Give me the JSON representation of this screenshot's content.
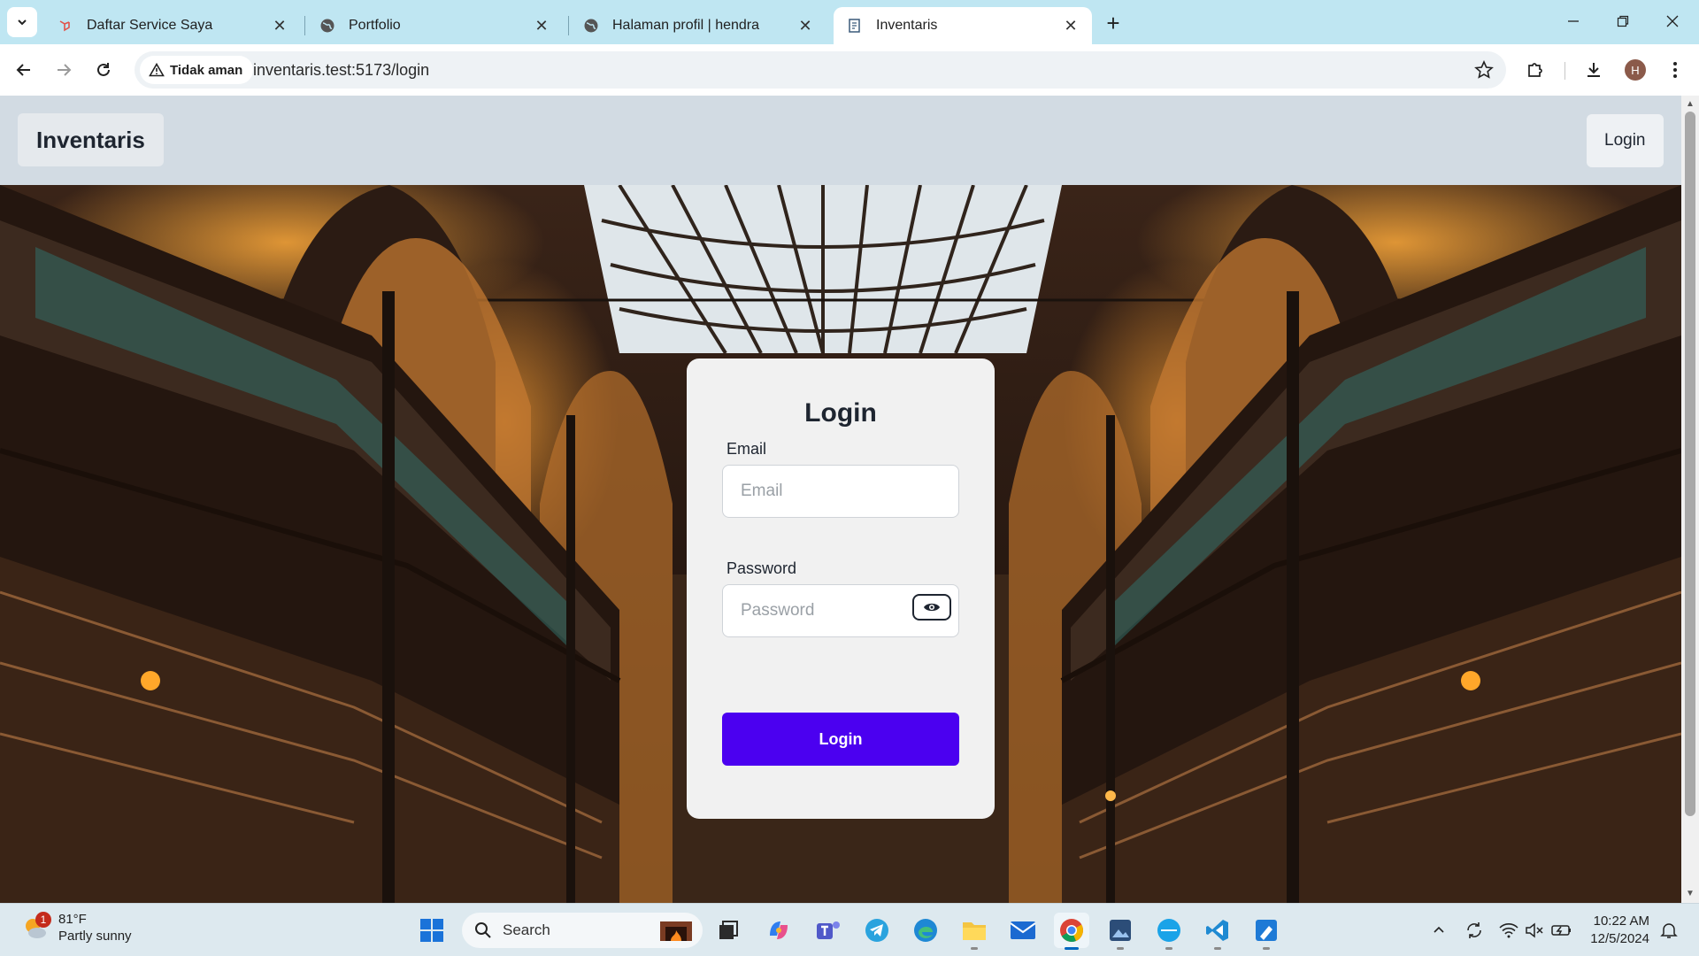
{
  "browser": {
    "tabs": [
      {
        "title": "Daftar Service Saya",
        "icon": "laravel-icon"
      },
      {
        "title": "Portfolio",
        "icon": "globe-icon"
      },
      {
        "title": "Halaman profil | hendra",
        "icon": "globe-icon"
      },
      {
        "title": "Inventaris",
        "icon": "inventory-icon",
        "active": true
      }
    ],
    "security_chip": "Tidak aman",
    "url": "inventaris.test:5173/login",
    "profile_initial": "H"
  },
  "app": {
    "brand": "Inventaris",
    "header_login": "Login",
    "login_card": {
      "title": "Login",
      "email_label": "Email",
      "email_placeholder": "Email",
      "password_label": "Password",
      "password_placeholder": "Password",
      "submit_label": "Login"
    },
    "colors": {
      "accent": "#4b00f0",
      "header_bg": "#d2dbe3",
      "card_bg": "#f1f1f1"
    }
  },
  "taskbar": {
    "weather_temp": "81°F",
    "weather_desc": "Partly sunny",
    "weather_badge": "1",
    "search_label": "Search",
    "time": "10:22 AM",
    "date": "12/5/2024"
  }
}
